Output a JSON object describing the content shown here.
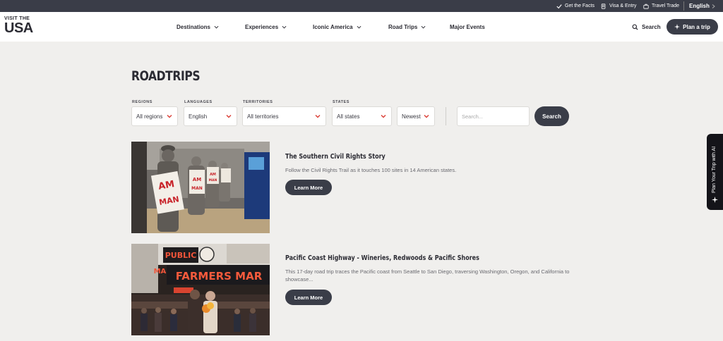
{
  "topbar": {
    "facts": "Get the Facts",
    "visa": "Visa & Entry",
    "trade": "Travel Trade",
    "language": "English"
  },
  "header": {
    "logo_top": "VISIT THE",
    "logo_bottom": "USA",
    "nav": [
      {
        "label": "Destinations",
        "has_dropdown": true
      },
      {
        "label": "Experiences",
        "has_dropdown": true
      },
      {
        "label": "Iconic America",
        "has_dropdown": true
      },
      {
        "label": "Road Trips",
        "has_dropdown": true
      },
      {
        "label": "Major Events",
        "has_dropdown": false
      }
    ],
    "search_label": "Search",
    "plan_label": "Plan a trip"
  },
  "page": {
    "title": "ROADTRIPS"
  },
  "filters": {
    "regions": {
      "label": "REGIONS",
      "value": "All regions"
    },
    "languages": {
      "label": "LANGUAGES",
      "value": "English"
    },
    "territories": {
      "label": "TERRITORIES",
      "value": "All territories"
    },
    "states": {
      "label": "STATES",
      "value": "All states"
    },
    "sort": {
      "value": "Newest"
    },
    "search_placeholder": "Search...",
    "search_button": "Search"
  },
  "cards": [
    {
      "title": "The Southern Civil Rights Story",
      "description": "Follow the Civil Rights Trail as it touches 100 sites in 14 American states.",
      "button": "Learn More",
      "image_sign_text": "I AM A MAN"
    },
    {
      "title": "Pacific Coast Highway - Wineries, Redwoods & Pacific Shores",
      "description": "This 17-day road trip traces the Pacific coast from Seattle to San Diego, traversing Washington, Oregon, and California to showcase...",
      "button": "Learn More",
      "image_sign_text": "FARMERS MAR"
    }
  ],
  "side_tab": {
    "label": "Plan Your Trip with AI"
  },
  "colors": {
    "dark": "#3a3d48",
    "background": "#f0efed",
    "accent_red": "#d9342b"
  }
}
